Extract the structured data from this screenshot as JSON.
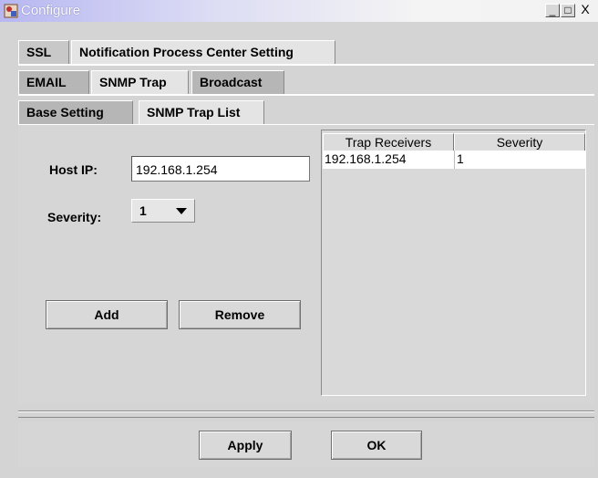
{
  "window": {
    "title": "Configure",
    "controls": {
      "minimize": "_",
      "maximize": "□",
      "close": "X"
    }
  },
  "tabs_level1": [
    {
      "label": "SSL",
      "selected": false
    },
    {
      "label": "Notification Process Center Setting",
      "selected": true
    }
  ],
  "tabs_level2": [
    {
      "label": "EMAIL",
      "selected": false
    },
    {
      "label": "SNMP Trap",
      "selected": true
    },
    {
      "label": "Broadcast",
      "selected": false
    }
  ],
  "tabs_level3": [
    {
      "label": "Base Setting",
      "selected": false
    },
    {
      "label": "SNMP Trap List",
      "selected": true
    }
  ],
  "form": {
    "host_ip_label": "Host IP:",
    "host_ip_value": "192.168.1.254",
    "severity_label": "Severity:",
    "severity_value": "1",
    "add_label": "Add",
    "remove_label": "Remove"
  },
  "table": {
    "columns": [
      "Trap Receivers",
      "Severity"
    ],
    "rows": [
      [
        "192.168.1.254",
        "1"
      ]
    ]
  },
  "footer": {
    "apply_label": "Apply",
    "ok_label": "OK"
  },
  "colors": {
    "titlebar_start": "#b7b7f2",
    "selected_tab": "#e4e4e4",
    "panel": "#d6d6d6"
  },
  "icons": [
    "app-icon",
    "minimize-icon",
    "maximize-icon",
    "close-icon",
    "chevron-down-icon"
  ]
}
